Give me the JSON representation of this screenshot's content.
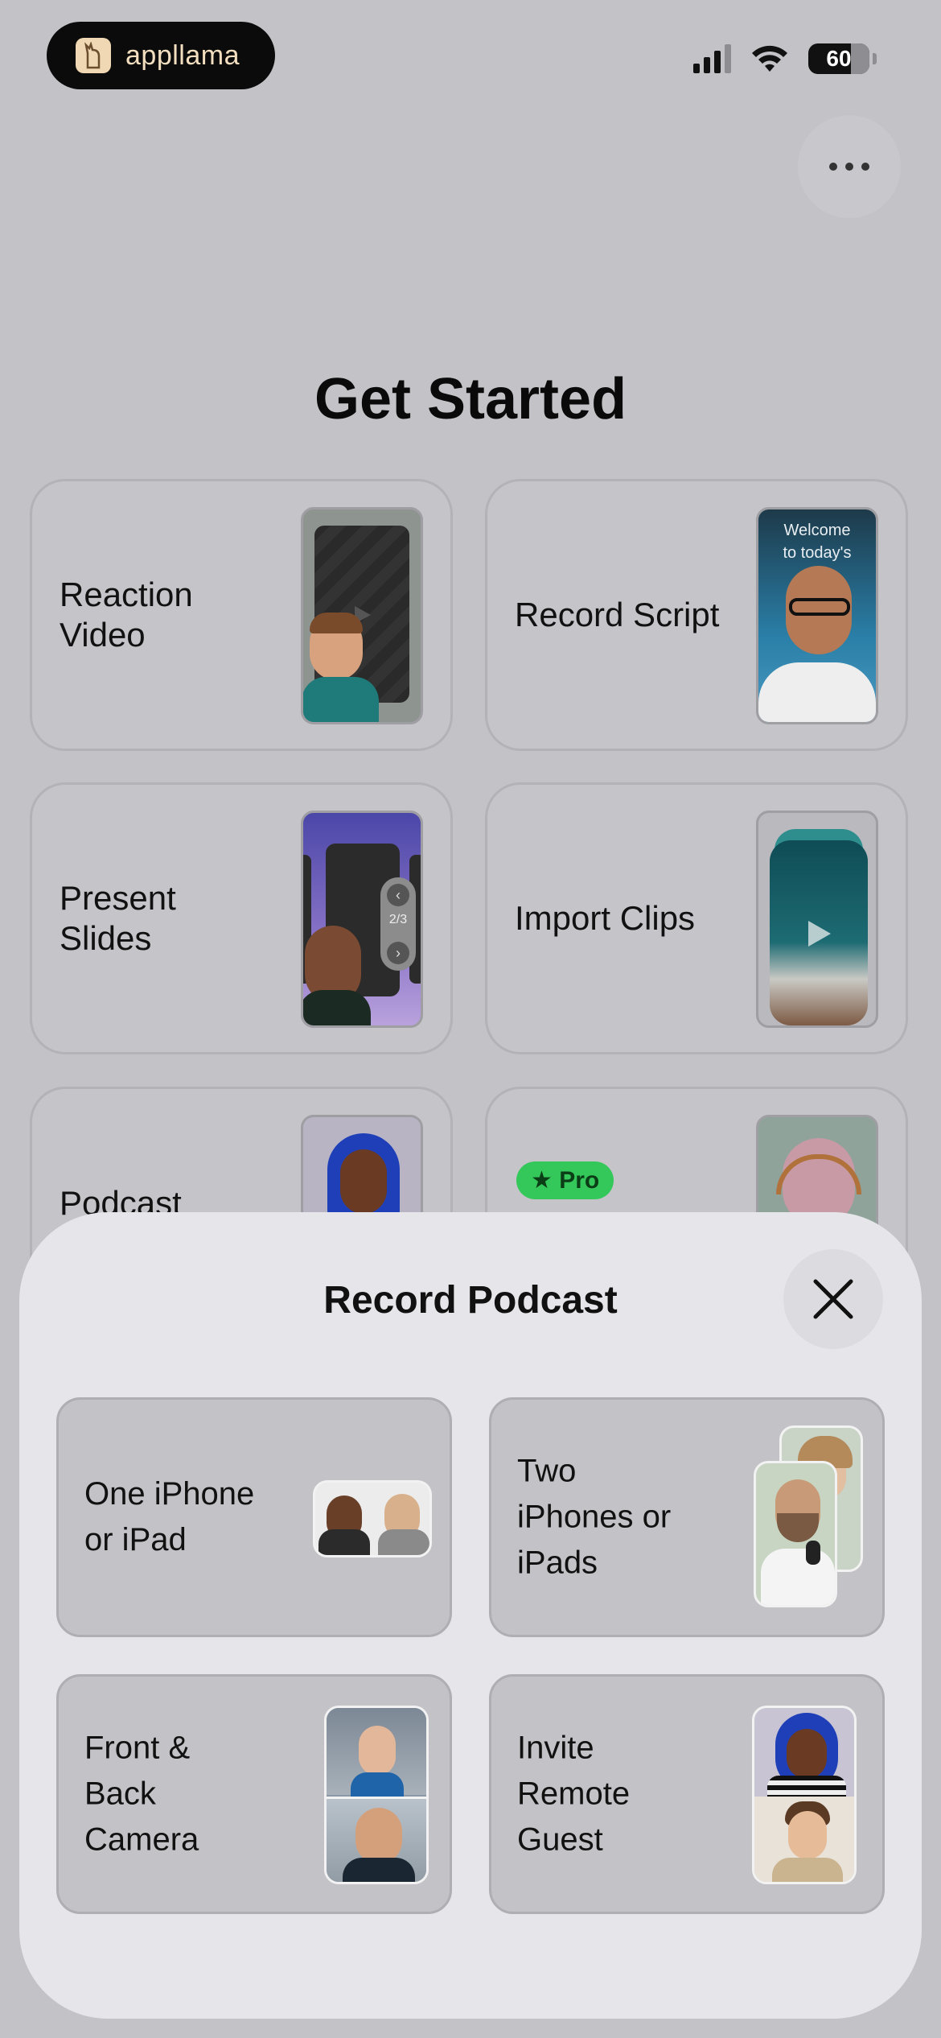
{
  "status_bar": {
    "brand": "appllama",
    "battery": "60"
  },
  "page": {
    "title": "Get Started"
  },
  "cards": [
    {
      "label": "Reaction\nVideo"
    },
    {
      "label": "Record Script",
      "thumb_text": "Welcome\nto today's"
    },
    {
      "label": "Present\nSlides",
      "slide_counter": "2/3"
    },
    {
      "label": "Import Clips"
    },
    {
      "label": "Podcast"
    },
    {
      "badge": "★ Pro"
    }
  ],
  "sheet": {
    "title": "Record Podcast",
    "options": [
      {
        "label": "One iPhone\nor iPad"
      },
      {
        "label": "Two\niPhones or\niPads"
      },
      {
        "label": "Front &\nBack\nCamera"
      },
      {
        "label": "Invite\nRemote\nGuest"
      }
    ]
  },
  "colors": {
    "pro_badge": "#34c759",
    "background": "#c3c2c7",
    "sheet": "#e6e6ea"
  }
}
